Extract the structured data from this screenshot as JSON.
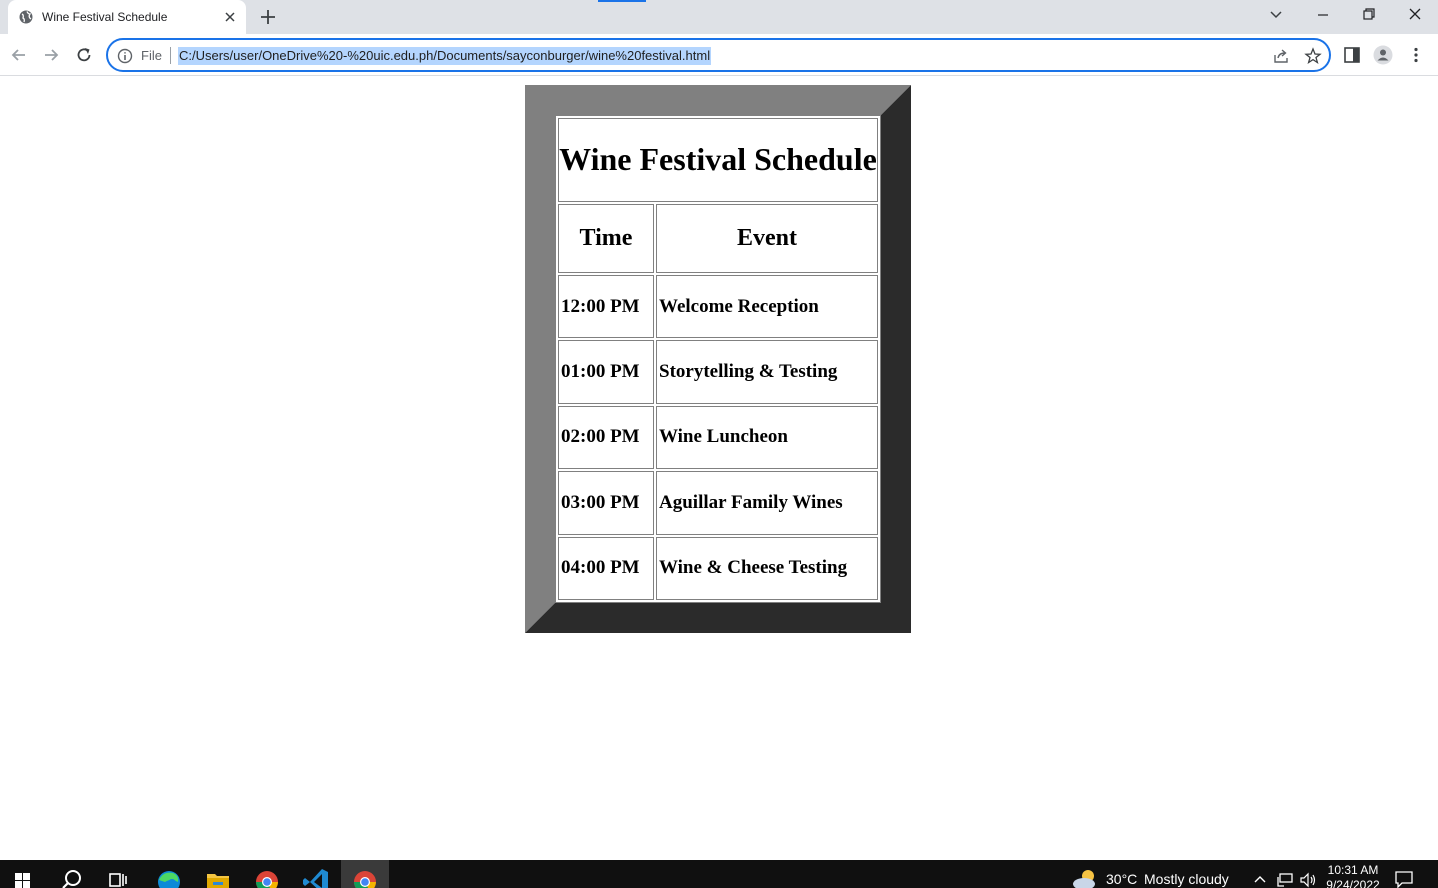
{
  "browser": {
    "tab": {
      "title": "Wine Festival Schedule"
    },
    "address_bar": {
      "scheme_label": "File",
      "url": "C:/Users/user/OneDrive%20-%20uic.edu.ph/Documents/sayconburger/wine%20festival.html"
    }
  },
  "page": {
    "table": {
      "caption": "Wine Festival Schedule",
      "headers": [
        "Time",
        "Event"
      ],
      "rows": [
        {
          "time": "12:00 PM",
          "event": "Welcome Reception"
        },
        {
          "time": "01:00 PM",
          "event": "Storytelling & Testing"
        },
        {
          "time": "02:00 PM",
          "event": "Wine Luncheon"
        },
        {
          "time": "03:00 PM",
          "event": "Aguillar Family Wines"
        },
        {
          "time": "04:00 PM",
          "event": "Wine & Cheese Testing"
        }
      ]
    },
    "colors": {
      "frame_light": "#808080",
      "frame_dark": "#2b2b2b"
    }
  },
  "taskbar": {
    "apps": [
      "windows-start-icon",
      "search-icon",
      "task-view-icon",
      "edge-icon",
      "file-explorer-icon",
      "chrome-icon",
      "vscode-icon",
      "chrome-active-icon"
    ],
    "weather": {
      "temperature": "30°C",
      "condition": "Mostly cloudy"
    },
    "clock": {
      "time": "10:31 AM",
      "date": "9/24/2022"
    }
  }
}
